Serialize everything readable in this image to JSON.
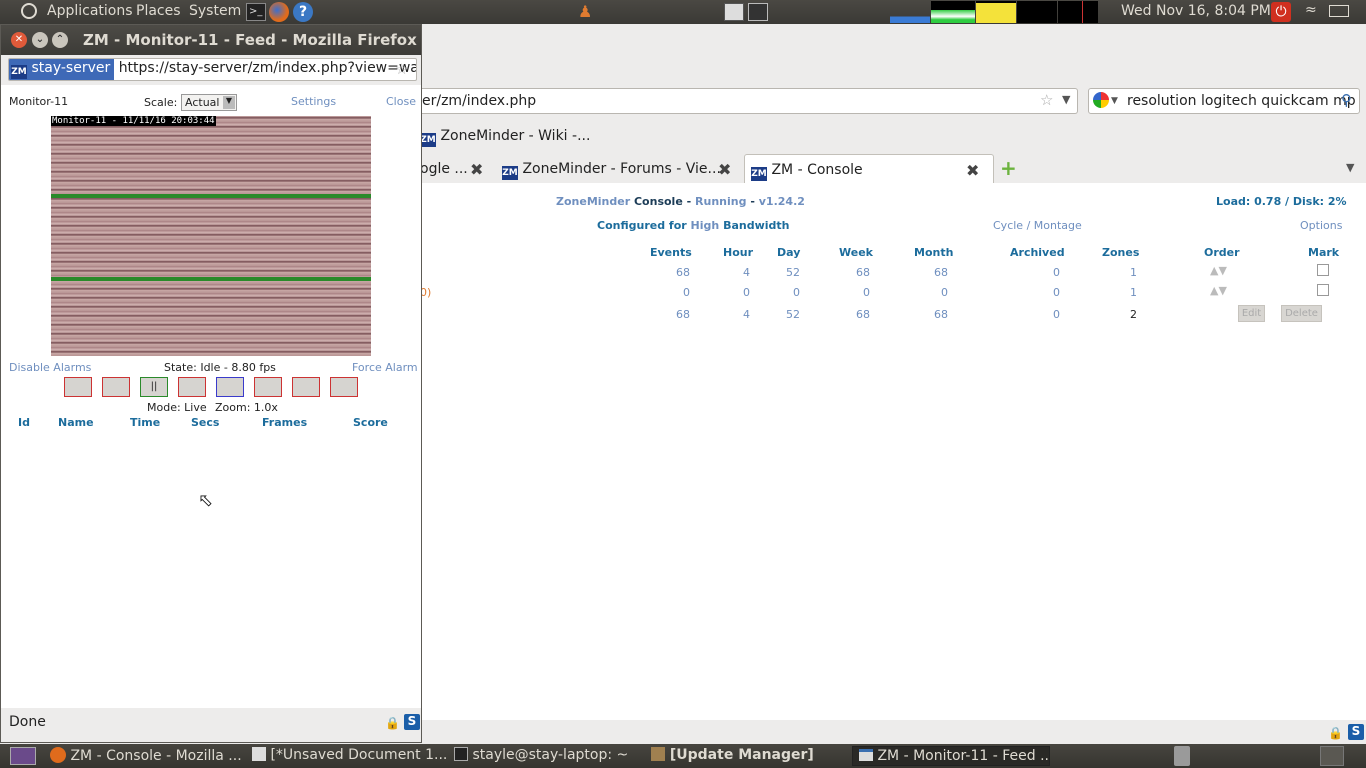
{
  "top_panel": {
    "applications": "Applications",
    "places": "Places",
    "system": "System",
    "clock": "Wed Nov 16,  8:04 PM"
  },
  "main_browser": {
    "url": "er/zm/index.php",
    "search_text": "resolution logitech quickcam mp",
    "bookmark": "ZoneMinder - Wiki -...",
    "tabs": [
      {
        "label": "ogle ..."
      },
      {
        "label": "ZoneMinder - Forums - Vie..."
      },
      {
        "label": "ZM - Console"
      }
    ],
    "zm_icon": "ZM",
    "console": {
      "title_app": "ZoneMinder",
      "title_console": "Console",
      "dash1": "-",
      "state": "Running",
      "dash2": "-",
      "version": "v1.24.2",
      "load": "Load: 0.78 / Disk: 2%",
      "configured_prefix": "Configured for",
      "bandwidth": "High",
      "bandwidth_suffix": "Bandwidth",
      "cycle": "Cycle",
      "slash": "/",
      "montage": "Montage",
      "options": "Options",
      "headers": [
        "Events",
        "Hour",
        "Day",
        "Week",
        "Month",
        "Archived",
        "Zones",
        "Order",
        "Mark"
      ],
      "rows": [
        {
          "prefix": "",
          "events": "68",
          "hour": "4",
          "day": "52",
          "week": "68",
          "month": "68",
          "archived": "0",
          "zones": "1"
        },
        {
          "prefix": "0)",
          "events": "0",
          "hour": "0",
          "day": "0",
          "week": "0",
          "month": "0",
          "archived": "0",
          "zones": "1"
        }
      ],
      "totals": {
        "events": "68",
        "hour": "4",
        "day": "52",
        "week": "68",
        "month": "68",
        "archived": "0",
        "zones": "2"
      },
      "edit": "Edit",
      "delete": "Delete"
    }
  },
  "popup": {
    "title": "ZM - Monitor-11 - Feed - Mozilla Firefox",
    "url_host": "stay-server",
    "url": "https://stay-server/zm/index.php?view=wa",
    "monitor_name": "Monitor-11",
    "scale_label": "Scale:",
    "scale_value": "Actual",
    "settings": "Settings",
    "close": "Close",
    "overlay": "Monitor-11 - 11/11/16 20:03:44",
    "disable_alarms": "Disable Alarms",
    "state": "State:  Idle - 8.80 fps",
    "force_alarm": "Force Alarm",
    "pause_glyph": "||",
    "mode": "Mode:  Live",
    "zoom": "Zoom:  1.0x",
    "event_headers": [
      "Id",
      "Name",
      "Time",
      "Secs",
      "Frames",
      "Score"
    ],
    "status": "Done"
  },
  "taskbar": [
    {
      "label": "ZM - Console - Mozilla ..."
    },
    {
      "label": "[*Unsaved Document 1..."
    },
    {
      "label": "stayle@stay-laptop: ~"
    },
    {
      "label": "[Update Manager]"
    },
    {
      "label": "ZM - Monitor-11 - Feed ..."
    }
  ],
  "colors": {
    "zm_blue": "#1c6c9c",
    "zm_link": "#6f8fbf",
    "panel": "#3c3b37",
    "alarm_red": "#cc3333"
  }
}
